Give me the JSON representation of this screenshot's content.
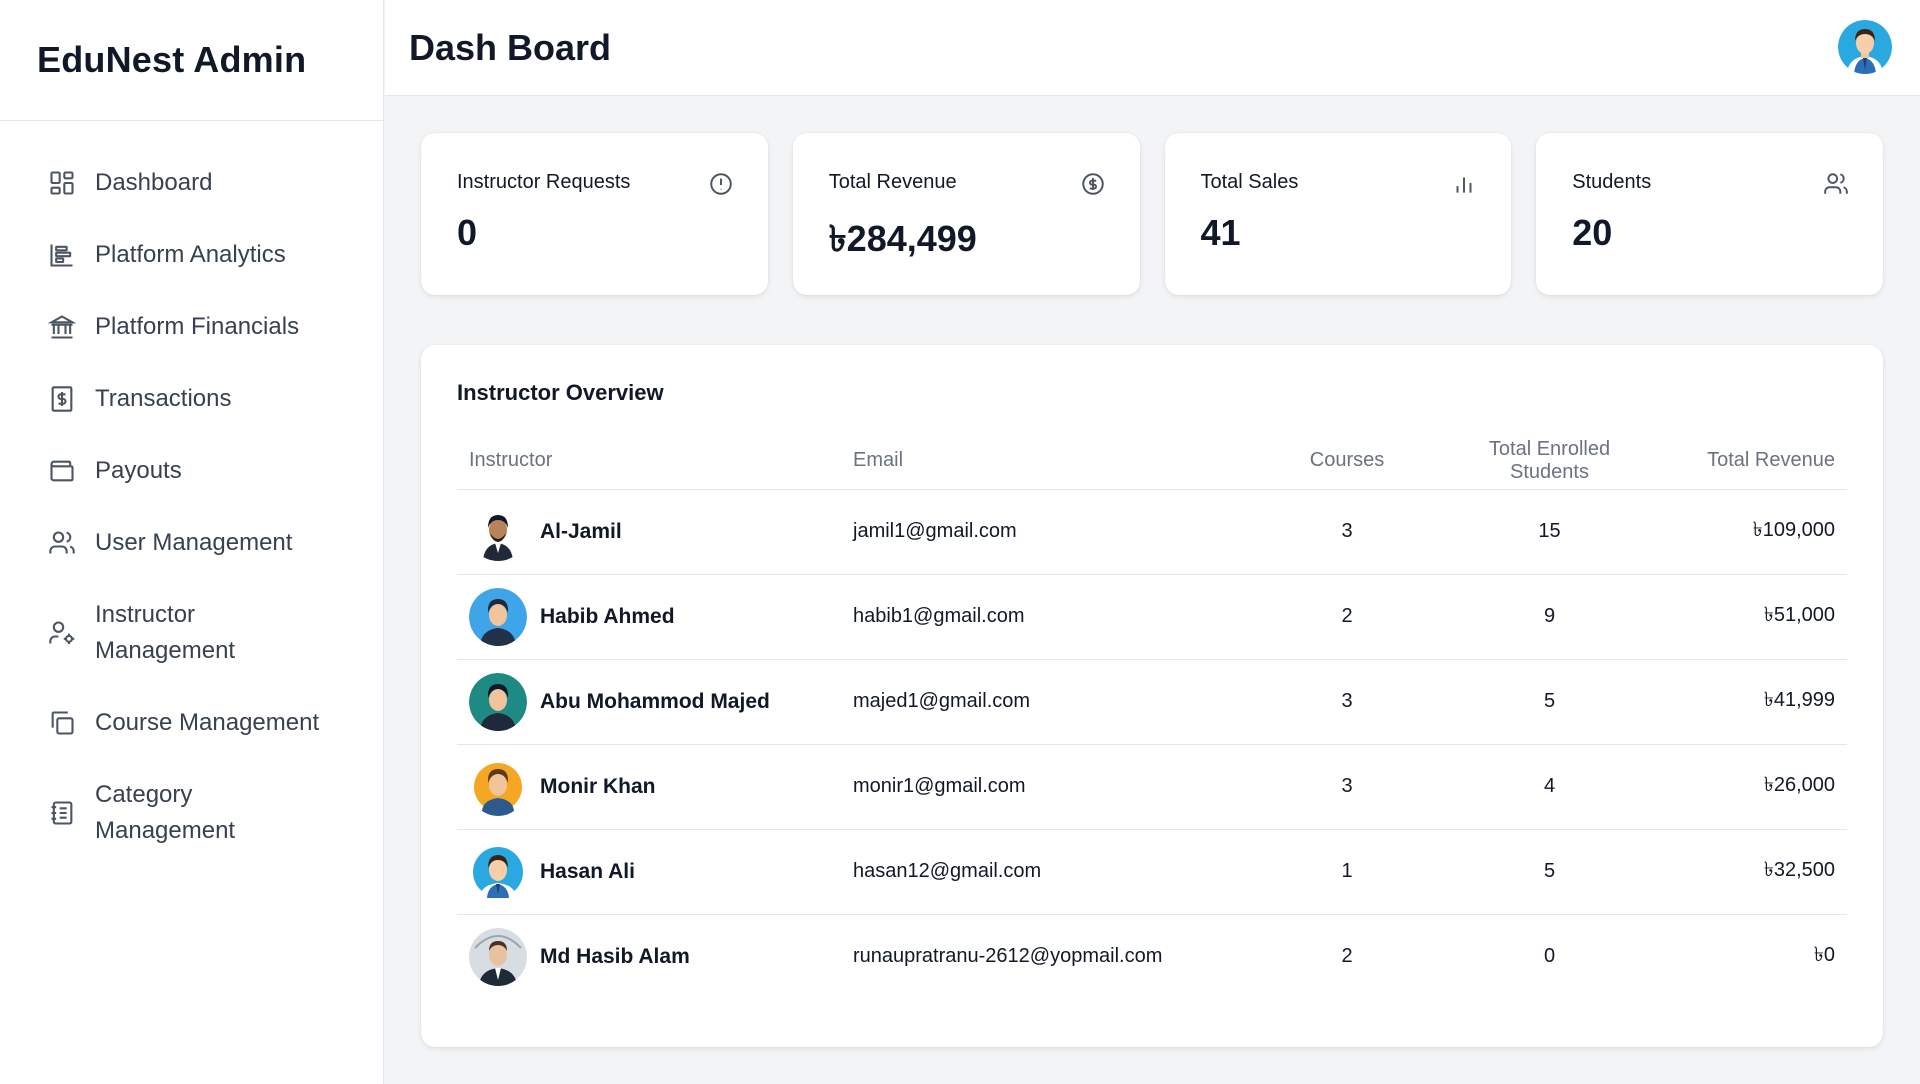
{
  "sidebar": {
    "brand": "EduNest Admin",
    "items": [
      {
        "label": "Dashboard",
        "icon": "dashboard-icon"
      },
      {
        "label": "Platform Analytics",
        "icon": "analytics-icon"
      },
      {
        "label": "Platform Financials",
        "icon": "bank-icon"
      },
      {
        "label": "Transactions",
        "icon": "receipt-icon"
      },
      {
        "label": "Payouts",
        "icon": "wallet-icon"
      },
      {
        "label": "User Management",
        "icon": "users-icon"
      },
      {
        "label": "Instructor Management",
        "icon": "user-cog-icon"
      },
      {
        "label": "Course Management",
        "icon": "copy-icon"
      },
      {
        "label": "Category Management",
        "icon": "notebook-icon"
      }
    ]
  },
  "header": {
    "title": "Dash Board"
  },
  "stats": [
    {
      "label": "Instructor Requests",
      "value": "0",
      "icon": "alert-circle-icon"
    },
    {
      "label": "Total Revenue",
      "value": "৳284,499",
      "icon": "dollar-circle-icon"
    },
    {
      "label": "Total Sales",
      "value": "41",
      "icon": "bar-chart-icon"
    },
    {
      "label": "Students",
      "value": "20",
      "icon": "users-icon"
    }
  ],
  "overview": {
    "title": "Instructor Overview",
    "columns": [
      "Instructor",
      "Email",
      "Courses",
      "Total Enrolled Students",
      "Total Revenue"
    ],
    "rows": [
      {
        "name": "Al-Jamil",
        "email": "jamil1@gmail.com",
        "courses": "3",
        "enrolled": "15",
        "revenue": "৳109,000"
      },
      {
        "name": "Habib Ahmed",
        "email": "habib1@gmail.com",
        "courses": "2",
        "enrolled": "9",
        "revenue": "৳51,000"
      },
      {
        "name": "Abu Mohammod Majed",
        "email": "majed1@gmail.com",
        "courses": "3",
        "enrolled": "5",
        "revenue": "৳41,999"
      },
      {
        "name": "Monir Khan",
        "email": "monir1@gmail.com",
        "courses": "3",
        "enrolled": "4",
        "revenue": "৳26,000"
      },
      {
        "name": "Hasan Ali",
        "email": "hasan12@gmail.com",
        "courses": "1",
        "enrolled": "5",
        "revenue": "৳32,500"
      },
      {
        "name": "Md Hasib Alam",
        "email": "runaupratranu-2612@yopmail.com",
        "courses": "2",
        "enrolled": "0",
        "revenue": "৳0"
      }
    ]
  }
}
